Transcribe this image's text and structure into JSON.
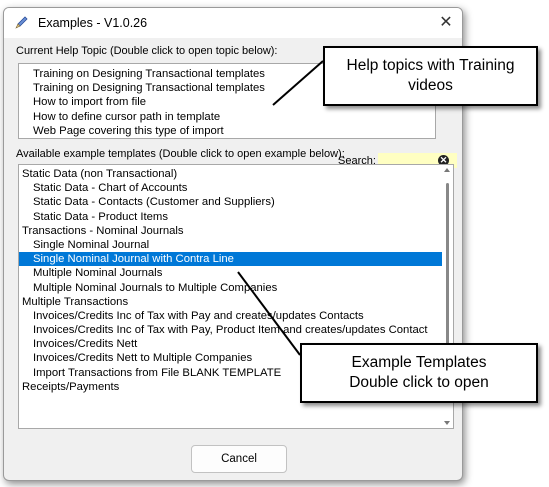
{
  "background_text": "...",
  "window": {
    "title": "Examples - V1.0.26",
    "close_symbol": "✕"
  },
  "help_topics": {
    "label": "Current Help Topic (Double click to open topic below):",
    "items": [
      "Training on Designing Transactional templates",
      "Training on Designing Transactional templates",
      "How to import from file",
      "How to define cursor path in template",
      "Web Page covering this type of import"
    ]
  },
  "templates": {
    "label": "Available example templates (Double click to open example below):",
    "selected_index": 6,
    "items": [
      {
        "label": "Static Data (non Transactional)",
        "level": 1
      },
      {
        "label": "Static Data - Chart of Accounts",
        "level": 2
      },
      {
        "label": "Static Data - Contacts (Customer and Suppliers)",
        "level": 2
      },
      {
        "label": "Static Data - Product Items",
        "level": 2
      },
      {
        "label": "Transactions - Nominal Journals",
        "level": 1
      },
      {
        "label": "Single Nominal Journal",
        "level": 2
      },
      {
        "label": "Single Nominal Journal with Contra Line",
        "level": 2
      },
      {
        "label": "Multiple Nominal Journals",
        "level": 2
      },
      {
        "label": "Multiple Nominal Journals to Multiple Companies",
        "level": 2
      },
      {
        "label": "Multiple Transactions",
        "level": 1
      },
      {
        "label": "Invoices/Credits Inc of Tax with Pay and creates/updates Contacts",
        "level": 2
      },
      {
        "label": "Invoices/Credits Inc of Tax with Pay, Product Item and creates/updates Contact",
        "level": 2
      },
      {
        "label": "Invoices/Credits Nett",
        "level": 2
      },
      {
        "label": "Invoices/Credits Nett to Multiple Companies",
        "level": 2
      },
      {
        "label": "Import Transactions from File BLANK TEMPLATE",
        "level": 2
      },
      {
        "label": "Receipts/Payments",
        "level": 1
      }
    ]
  },
  "search": {
    "label": "Search:",
    "value": "",
    "clear_symbol": "✕"
  },
  "cancel_label": "Cancel",
  "callouts": {
    "help": [
      "Help topics with Training",
      "videos"
    ],
    "templates": [
      "Example Templates",
      "Double click to open"
    ]
  },
  "colors": {
    "selection": "#0078d7",
    "search_bg": "#ffffc2",
    "dialog_bg": "#f0f0f0"
  },
  "icons": {
    "app": "pen-icon",
    "close": "close-icon",
    "clear": "clear-search-icon"
  }
}
